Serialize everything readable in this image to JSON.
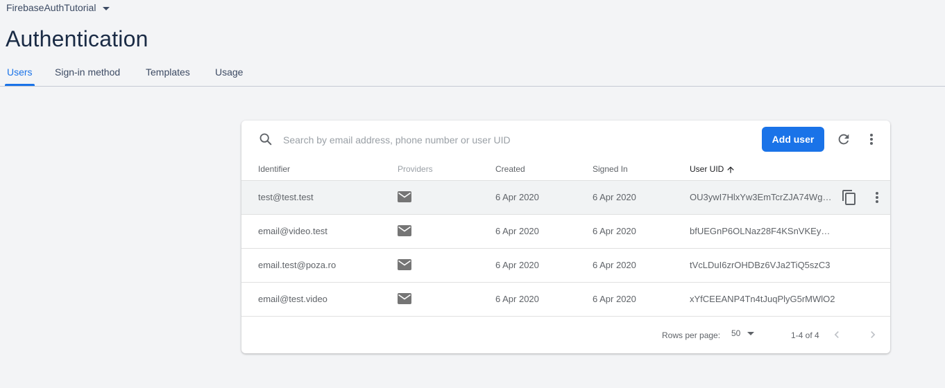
{
  "project": {
    "name": "FirebaseAuthTutorial"
  },
  "page": {
    "title": "Authentication"
  },
  "tabs": [
    {
      "label": "Users"
    },
    {
      "label": "Sign-in method"
    },
    {
      "label": "Templates"
    },
    {
      "label": "Usage"
    }
  ],
  "colors": {
    "accent": "#1a73e8",
    "title": "#1a2b45",
    "background": "#f3f4f6"
  },
  "toolbar": {
    "search_placeholder": "Search by email address, phone number or user UID",
    "add_user_label": "Add user",
    "refresh_icon": "refresh-icon",
    "more_icon": "more-vert-icon"
  },
  "table": {
    "columns": [
      "Identifier",
      "Providers",
      "Created",
      "Signed In",
      "User UID"
    ],
    "sort_column": "User UID",
    "sort_direction": "ascending",
    "rows": [
      {
        "identifier": "test@test.test",
        "provider": "email-icon",
        "created": "6 Apr 2020",
        "signed_in": "6 Apr 2020",
        "uid": "OU3ywI7HlxYw3EmTcrZJA74WgO…"
      },
      {
        "identifier": "email@video.test",
        "provider": "email-icon",
        "created": "6 Apr 2020",
        "signed_in": "6 Apr 2020",
        "uid": "bfUEGnP6OLNaz28F4KSnVKEymR…"
      },
      {
        "identifier": "email.test@poza.ro",
        "provider": "email-icon",
        "created": "6 Apr 2020",
        "signed_in": "6 Apr 2020",
        "uid": "tVcLDuI6zrOHDBz6VJa2TiQ5szC3"
      },
      {
        "identifier": "email@test.video",
        "provider": "email-icon",
        "created": "6 Apr 2020",
        "signed_in": "6 Apr 2020",
        "uid": "xYfCEEANP4Tn4tJuqPlyG5rMWlO2"
      }
    ]
  },
  "pagination": {
    "rows_per_page_label": "Rows per page:",
    "rows_per_page_value": "50",
    "range": "1-4 of 4"
  }
}
